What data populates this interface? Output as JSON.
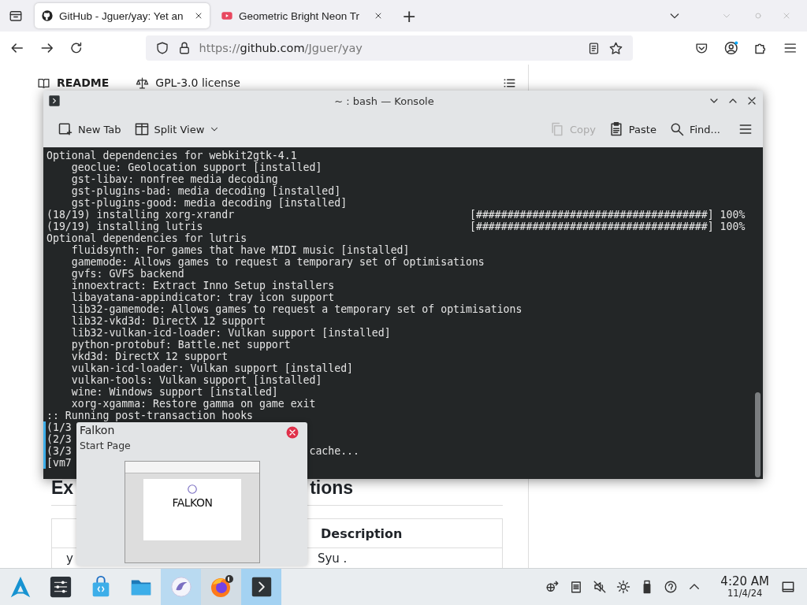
{
  "browser": {
    "tabs": [
      {
        "title": "GitHub - Jguer/yay: Yet an",
        "kind": "github",
        "selected": true
      },
      {
        "title": "Geometric Bright Neon Tr",
        "kind": "video",
        "selected": false
      }
    ],
    "new_tab": "+",
    "url_prefix": "https://",
    "url_host": "github.com",
    "url_path": "/Jguer/yay",
    "page": {
      "readme_tab": "README",
      "license_tab": "GPL-3.0 license",
      "heading_parts": [
        "Ex",
        "tions"
      ],
      "table_header": "Description",
      "row_cells": [
        "y",
        "Syu ."
      ]
    }
  },
  "konsole": {
    "title": "~ : bash — Konsole",
    "toolbar": [
      {
        "label": "New Tab",
        "kind": "newtab",
        "disabled": false
      },
      {
        "label": "Split View",
        "kind": "split",
        "disabled": false
      },
      {
        "label": "Copy",
        "kind": "copy",
        "disabled": true
      },
      {
        "label": "Paste",
        "kind": "paste",
        "disabled": false
      },
      {
        "label": "Find...",
        "kind": "find",
        "disabled": false
      }
    ],
    "lines": [
      {
        "text": "Optional dependencies for webkit2gtk-4.1",
        "marked": false
      },
      {
        "text": "    geoclue: Geolocation support [installed]",
        "marked": false
      },
      {
        "text": "    gst-libav: nonfree media decoding",
        "marked": false
      },
      {
        "text": "    gst-plugins-bad: media decoding [installed]",
        "marked": false
      },
      {
        "text": "    gst-plugins-good: media decoding [installed]",
        "marked": false
      },
      {
        "text": "(18/19) installing xorg-xrandr",
        "progress": "[#####################################] 100%",
        "marked": false
      },
      {
        "text": "(19/19) installing lutris",
        "progress": "[#####################################] 100%",
        "marked": false
      },
      {
        "text": "Optional dependencies for lutris",
        "marked": false
      },
      {
        "text": "    fluidsynth: For games that have MIDI music [installed]",
        "marked": false
      },
      {
        "text": "    gamemode: Allows games to request a temporary set of optimisations",
        "marked": false
      },
      {
        "text": "    gvfs: GVFS backend",
        "marked": false
      },
      {
        "text": "    innoextract: Extract Inno Setup installers",
        "marked": false
      },
      {
        "text": "    libayatana-appindicator: tray icon support",
        "marked": false
      },
      {
        "text": "    lib32-gamemode: Allows games to request a temporary set of optimisations",
        "marked": false
      },
      {
        "text": "    lib32-vkd3d: DirectX 12 support",
        "marked": false
      },
      {
        "text": "    lib32-vulkan-icd-loader: Vulkan support [installed]",
        "marked": false
      },
      {
        "text": "    python-protobuf: Battle.net support",
        "marked": false
      },
      {
        "text": "    vkd3d: DirectX 12 support",
        "marked": false
      },
      {
        "text": "    vulkan-icd-loader: Vulkan support [installed]",
        "marked": false
      },
      {
        "text": "    vulkan-tools: Vulkan support [installed]",
        "marked": false
      },
      {
        "text": "    wine: Windows support [installed]",
        "marked": false
      },
      {
        "text": "    xorg-xgamma: Restore gamma on game exit",
        "marked": false
      },
      {
        "text": ":: Running post-transaction hooks",
        "marked": false
      },
      {
        "text": "(1/3",
        "marked": true
      },
      {
        "text": "(2/3",
        "marked": true
      },
      {
        "text": "(3/3",
        "tail": "cache...",
        "marked": true
      },
      {
        "text": "[vm7",
        "marked": true
      }
    ]
  },
  "tooltip": {
    "title": "Falkon",
    "subtitle": "Start Page",
    "thumbnail_logo": "FALKON"
  },
  "taskbar": {
    "apps": [
      {
        "kind": "settings",
        "running": false,
        "hovered": false,
        "selected": false
      },
      {
        "kind": "store",
        "running": false,
        "hovered": false,
        "selected": false
      },
      {
        "kind": "folder",
        "running": false,
        "hovered": false,
        "selected": false
      },
      {
        "kind": "falkon",
        "running": true,
        "hovered": true,
        "selected": false
      },
      {
        "kind": "firefox",
        "running": true,
        "hovered": false,
        "selected": false
      },
      {
        "kind": "terminal",
        "running": true,
        "hovered": false,
        "selected": true
      }
    ],
    "tray": [
      {
        "kind": "network"
      },
      {
        "kind": "clipboard"
      },
      {
        "kind": "mute"
      },
      {
        "kind": "brightness"
      },
      {
        "kind": "usb"
      },
      {
        "kind": "help"
      },
      {
        "kind": "expand"
      }
    ],
    "clock": {
      "time": "4:20 AM",
      "date": "11/4/24"
    }
  }
}
